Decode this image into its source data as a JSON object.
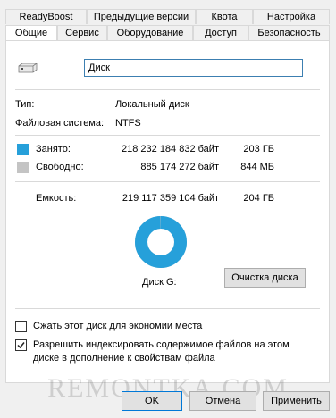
{
  "tabs_back": [
    "ReadyBoost",
    "Предыдущие версии",
    "Квота",
    "Настройка"
  ],
  "tabs_front": [
    "Общие",
    "Сервис",
    "Оборудование",
    "Доступ",
    "Безопасность"
  ],
  "drive": {
    "icon": "drive-icon",
    "name_value": "Диск",
    "type_label": "Тип:",
    "type_value": "Локальный диск",
    "fs_label": "Файловая система:",
    "fs_value": "NTFS"
  },
  "usage": {
    "used_label": "Занято:",
    "used_bytes": "218 232 184 832 байт",
    "used_size": "203 ГБ",
    "used_color": "#26a0da",
    "free_label": "Свободно:",
    "free_bytes": "885 174 272 байт",
    "free_size": "844 МБ",
    "free_color": "#c4c4c4",
    "capacity_label": "Емкость:",
    "capacity_bytes": "219 117 359 104 байт",
    "capacity_size": "204 ГБ",
    "used_fraction": 0.996
  },
  "disk_label": "Диск G:",
  "cleanup_button": "Очистка диска",
  "compress_label": "Сжать этот диск для экономии места",
  "compress_checked": false,
  "index_label_line1": "Разрешить индексировать содержимое файлов на этом",
  "index_label_line2": "диске в дополнение к свойствам файла",
  "index_checked": true,
  "buttons": {
    "ok": "OK",
    "cancel": "Отмена",
    "apply": "Применить"
  },
  "watermark": "REMONTKA.COM"
}
